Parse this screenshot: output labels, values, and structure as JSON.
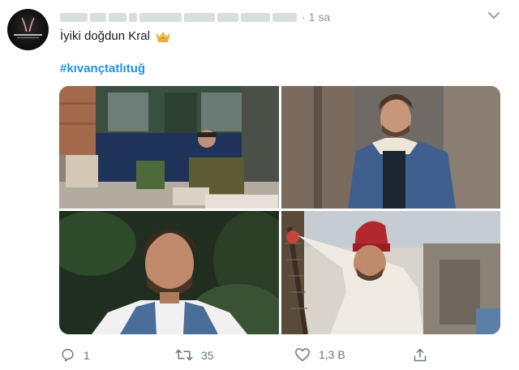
{
  "tweet": {
    "time_separator": "·",
    "time": "1 sa",
    "text": "İyiki doğdun Kral",
    "hashtag": "#kıvançtatlıtuğ"
  },
  "avatar": {
    "logo_text": "KIVANÇ TATLITUĞ"
  },
  "icons": {
    "more": "chevron-down-icon",
    "crown": "crown-emoji-icon",
    "reply": "reply-icon",
    "retweet": "retweet-icon",
    "like": "heart-icon",
    "share": "share-icon"
  },
  "actions": {
    "reply_count": "1",
    "retweet_count": "35",
    "like_count": "1,3 B"
  },
  "colors": {
    "link": "#1b95e0",
    "muted": "#657786",
    "text": "#14171a"
  }
}
